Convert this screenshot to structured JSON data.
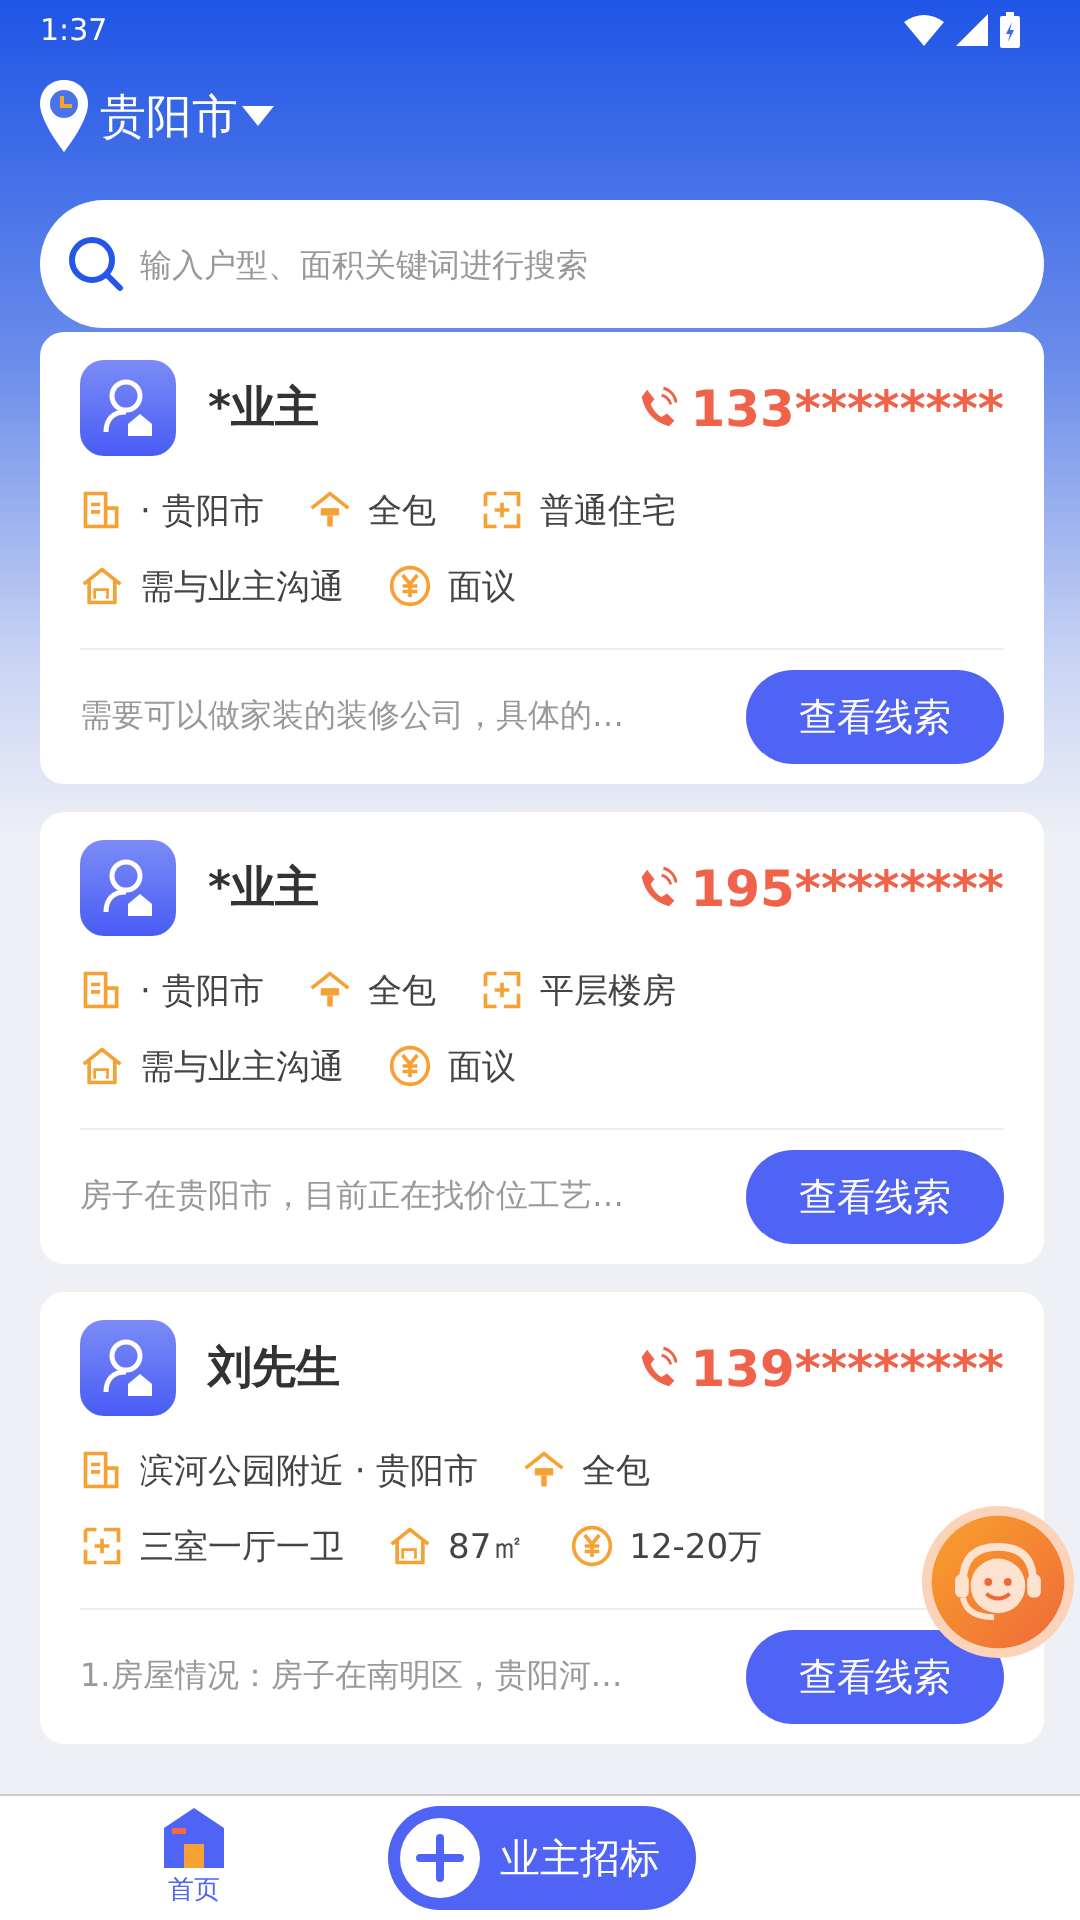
{
  "status_bar": {
    "time": "1:37"
  },
  "location": {
    "city": "贵阳市"
  },
  "search": {
    "placeholder": "输入户型、面积关键词进行搜索"
  },
  "leads": [
    {
      "name": "*业主",
      "phone": "133********",
      "tags": [
        [
          {
            "kind": "building",
            "text": "· 贵阳市"
          },
          {
            "kind": "package",
            "text": "全包"
          },
          {
            "kind": "plan",
            "text": "普通住宅"
          }
        ],
        [
          {
            "kind": "area",
            "text": "需与业主沟通"
          },
          {
            "kind": "price",
            "text": "面议"
          }
        ]
      ],
      "description": "需要可以做家装的装修公司，具体的…",
      "button": "查看线索"
    },
    {
      "name": "*业主",
      "phone": "195********",
      "tags": [
        [
          {
            "kind": "building",
            "text": "· 贵阳市"
          },
          {
            "kind": "package",
            "text": "全包"
          },
          {
            "kind": "plan",
            "text": "平层楼房"
          }
        ],
        [
          {
            "kind": "area",
            "text": "需与业主沟通"
          },
          {
            "kind": "price",
            "text": "面议"
          }
        ]
      ],
      "description": "房子在贵阳市，目前正在找价位工艺…",
      "button": "查看线索"
    },
    {
      "name": "刘先生",
      "phone": "139********",
      "tags": [
        [
          {
            "kind": "building",
            "text": "滨河公园附近 · 贵阳市"
          },
          {
            "kind": "package",
            "text": "全包"
          }
        ],
        [
          {
            "kind": "plan",
            "text": "三室一厅一卫"
          },
          {
            "kind": "area",
            "text": "87㎡"
          },
          {
            "kind": "price",
            "text": "12-20万"
          }
        ]
      ],
      "description": "1.房屋情况：房子在南明区，贵阳河…",
      "button": "查看线索"
    }
  ],
  "bottom_nav": {
    "home": {
      "label": "首页",
      "selected": true
    },
    "post_button": "业主招标"
  }
}
